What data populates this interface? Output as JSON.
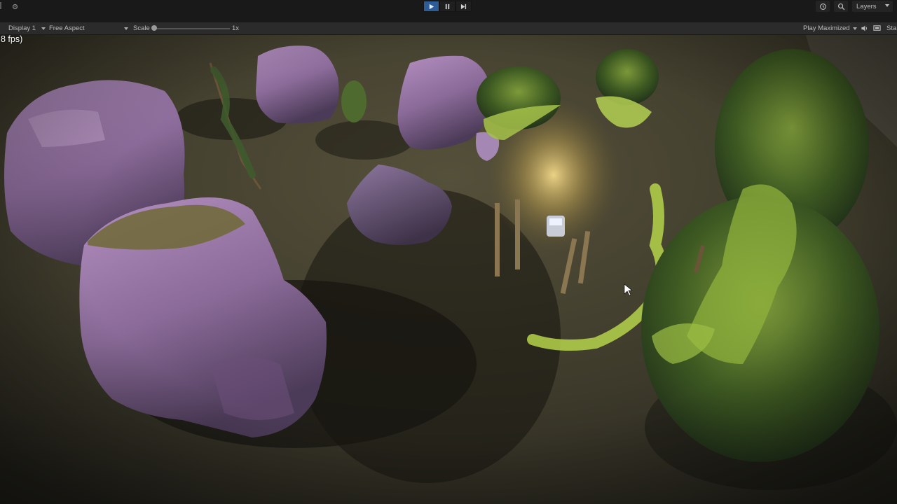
{
  "top_toolbar": {
    "play_buttons": [
      {
        "icon": "play-icon",
        "active": true
      },
      {
        "icon": "pause-icon",
        "active": false
      },
      {
        "icon": "step-icon",
        "active": false
      }
    ],
    "history_icon": "history-icon",
    "search_icon": "search-icon",
    "layers_label": "Layers"
  },
  "game_toolbar": {
    "display_label": "Display 1",
    "aspect_label": "Free Aspect",
    "scale_label": "Scale",
    "scale_value": "1x",
    "play_mode_label": "Play Maximized",
    "stats_label": "Sta"
  },
  "viewport": {
    "fps_text": "8 fps)"
  },
  "colors": {
    "accent_active": "#2d5c97",
    "toolbar_bg": "#191919",
    "game_toolbar_bg": "#2b2b2b"
  }
}
